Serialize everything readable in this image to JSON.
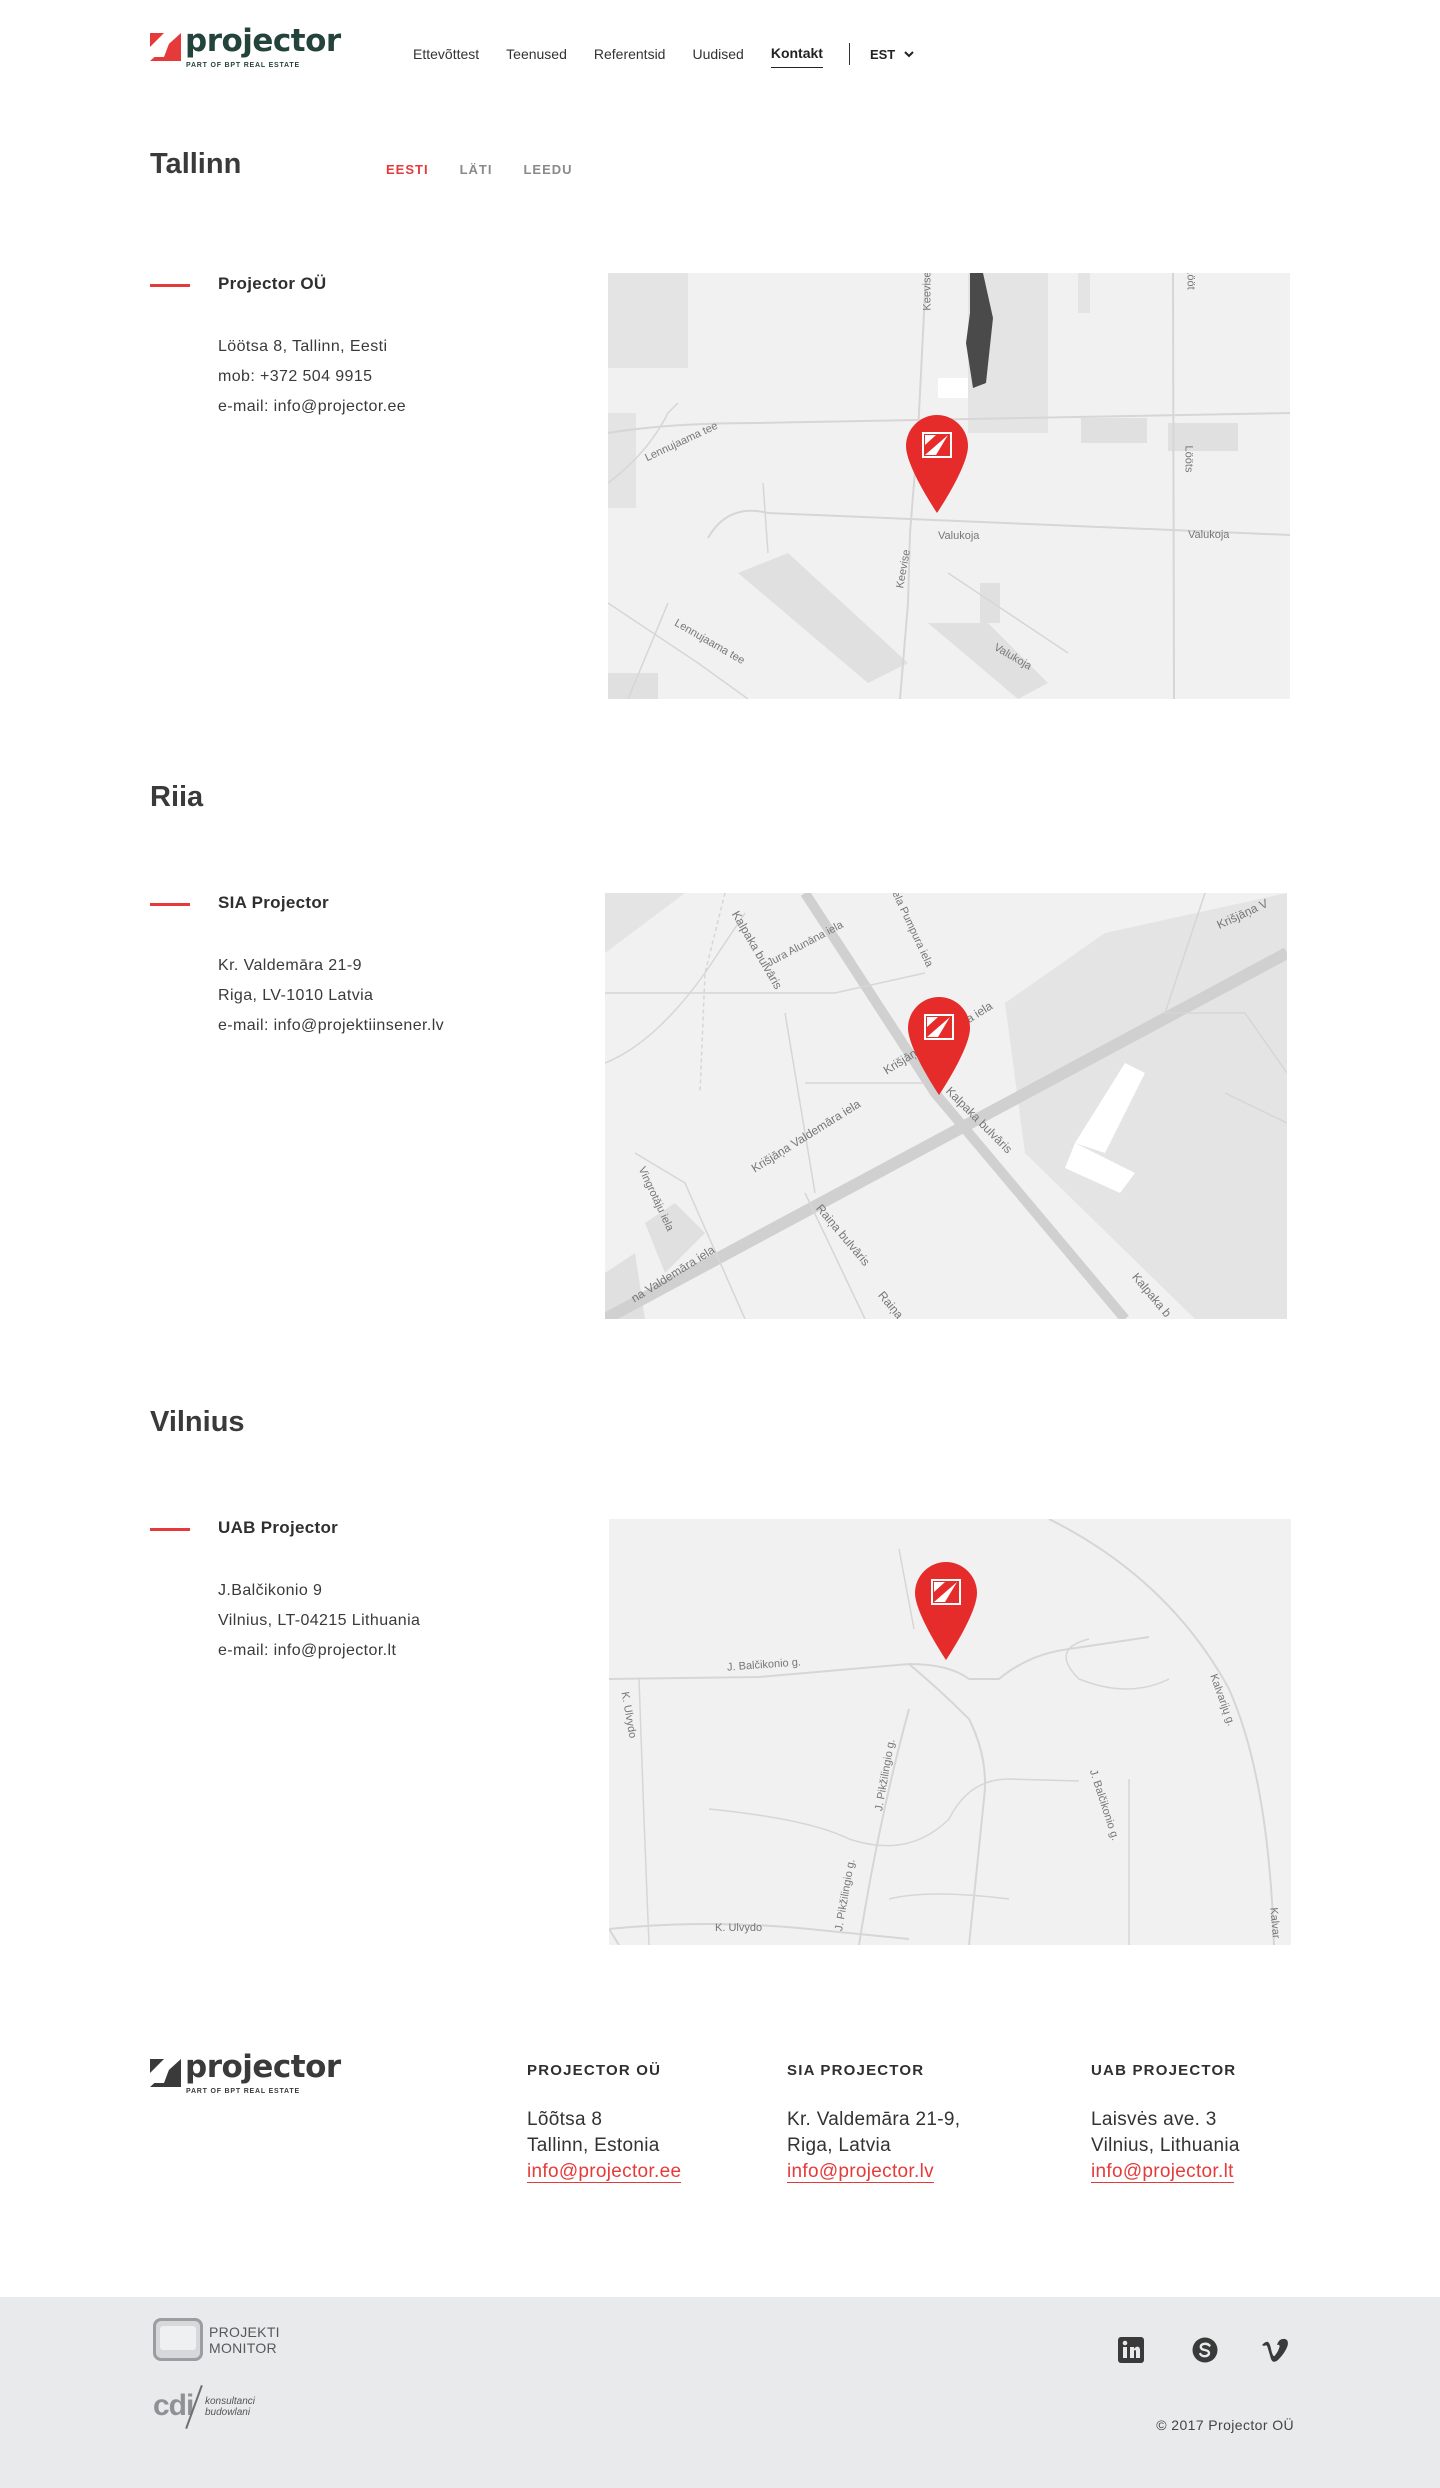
{
  "header": {
    "logo": {
      "word": "projector",
      "tagline": "PART OF BPT REAL ESTATE"
    },
    "nav": [
      {
        "label": "Ettevõttest",
        "active": false
      },
      {
        "label": "Teenused",
        "active": false
      },
      {
        "label": "Referentsid",
        "active": false
      },
      {
        "label": "Uudised",
        "active": false
      },
      {
        "label": "Kontakt",
        "active": true
      }
    ],
    "language": "EST"
  },
  "tabs": [
    {
      "label": "EESTI",
      "active": true
    },
    {
      "label": "LÄTI",
      "active": false
    },
    {
      "label": "LEEDU",
      "active": false
    }
  ],
  "sections": [
    {
      "city": "Tallinn",
      "company": "Projector OÜ",
      "address": [
        "Löötsa 8, Tallinn, Eesti",
        "mob: +372 504 9915",
        "e-mail: info@projector.ee"
      ],
      "map_labels": [
        "Lennujaama tee",
        "Lennujaama tee",
        "Keevise",
        "Keevise",
        "Valukoja",
        "Valukoja",
        "Valukoja",
        "Lööt",
        "Lööts"
      ]
    },
    {
      "city": "Riia",
      "company": "SIA Projector",
      "address": [
        "Kr. Valdemāra 21-9",
        "Riga, LV-1010 Latvia",
        "e-mail: info@projektiinsener.lv"
      ],
      "map_labels": [
        "Kalpaka bulvāris",
        "Jura Alunāna iela",
        "ela Pumpura iela",
        "Krišjāņa V",
        "Krišjāņa Valdemāra iela",
        "Kalpaka bulvāris",
        "Krišjāņa Valdemāra iela",
        "Vingrotāju iela",
        "na Valdemāra iela",
        "Raiņa bulvāris",
        "Raiņa",
        "Kalpaka b"
      ]
    },
    {
      "city": "Vilnius",
      "company": "UAB Projector",
      "address": [
        "J.Balčikonio 9",
        "Vilnius, LT-04215 Lithuania",
        "e-mail: info@projector.lt"
      ],
      "map_labels": [
        "J. Balčikonio g.",
        "K. Ulvydo",
        "J. Pikžilingio g.",
        "J. Balčikonio g.",
        "Kalvarijų g.",
        "J. Pikžilingio g.",
        "K. Ulvydo",
        "Kalvar"
      ]
    }
  ],
  "footer": {
    "logo": {
      "word": "projector",
      "tagline": "PART OF BPT REAL ESTATE"
    },
    "columns": [
      {
        "title": "PROJECTOR OÜ",
        "line1": "Lõõtsa 8",
        "line2": "Tallinn, Estonia",
        "email": "info@projector.ee"
      },
      {
        "title": "SIA PROJECTOR",
        "line1": "Kr. Valdemāra 21-9,",
        "line2": "Riga, Latvia",
        "email": "info@projector.lv"
      },
      {
        "title": "UAB PROJECTOR",
        "line1": "Laisvės ave. 3",
        "line2": "Vilnius, Lithuania",
        "email": "info@projector.lt"
      }
    ],
    "partners": {
      "pm_line1": "PROJEKTI",
      "pm_line2": "MONITOR",
      "cdi": "cdi",
      "cdi_line1": "konsultanci",
      "cdi_line2": "budowlani"
    },
    "social": [
      "linkedin-icon",
      "skype-icon",
      "vimeo-icon"
    ],
    "copyright": "© 2017 Projector OÜ"
  },
  "colors": {
    "accent": "#e63a3a",
    "logo": "#24443b",
    "map_bg": "#f1f1f1",
    "footer_bg": "#e9eaeb"
  }
}
